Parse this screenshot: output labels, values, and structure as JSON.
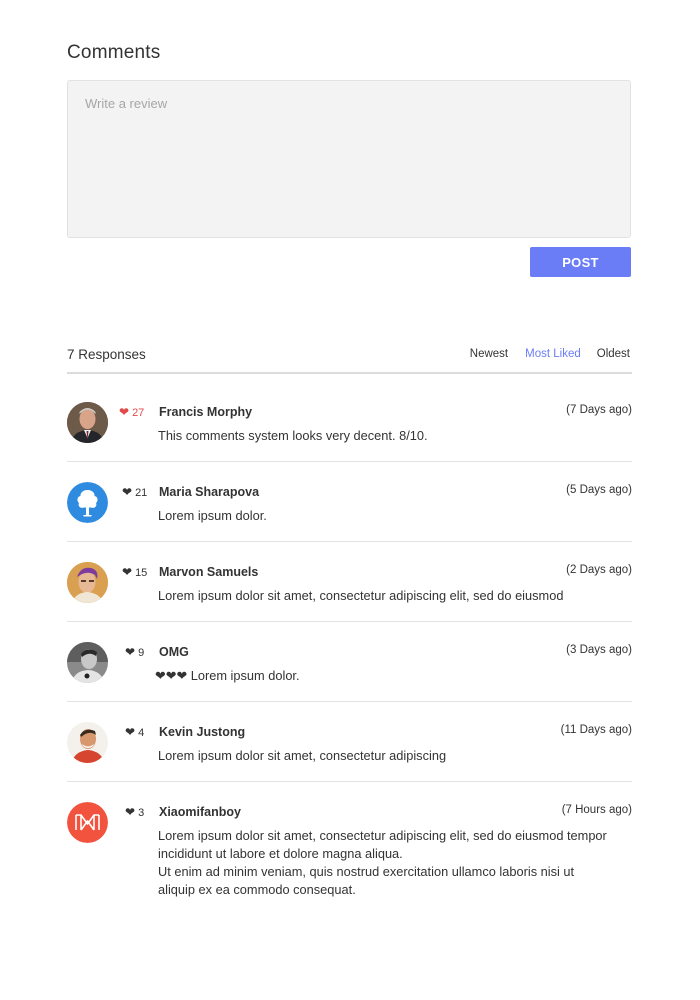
{
  "page": {
    "title": "Comments"
  },
  "composer": {
    "placeholder": "Write a review",
    "post_label": "POST"
  },
  "responses": {
    "count_label": "7 Responses",
    "sort_options": [
      "Newest",
      "Most Liked",
      "Oldest"
    ],
    "active_sort": "Most Liked"
  },
  "comments": [
    {
      "likes": "27",
      "author": "Francis Morphy",
      "time": "(7 Days ago)",
      "text": "This comments system looks very decent. 8/10.",
      "liked": true,
      "avatar": "avatar-photo-man-suit"
    },
    {
      "likes": "21",
      "author": "Maria Sharapova",
      "time": "(5 Days ago)",
      "text": "Lorem ipsum dolor.",
      "liked": false,
      "avatar": "avatar-tree-logo"
    },
    {
      "likes": "15",
      "author": "Marvon Samuels",
      "time": "(2 Days ago)",
      "text": "Lorem ipsum dolor sit amet, consectetur adipiscing elit, sed do eiusmod",
      "liked": false,
      "avatar": "avatar-photo-purple-hair"
    },
    {
      "likes": "9",
      "author": "OMG",
      "time": "(3 Days ago)",
      "text": "❤❤❤ Lorem ipsum dolor.",
      "liked": false,
      "avatar": "avatar-photo-grayscale"
    },
    {
      "likes": "4",
      "author": "Kevin Justong",
      "time": "(11 Days ago)",
      "text": "Lorem ipsum dolor sit amet, consectetur adipiscing",
      "liked": false,
      "avatar": "avatar-photo-red-shirt"
    },
    {
      "likes": "3",
      "author": "Xiaomifanboy",
      "time": "(7 Hours ago)",
      "text": "Lorem ipsum dolor sit amet, consectetur adipiscing elit, sed do eiusmod tempor incididunt ut labore et dolore magna aliqua.",
      "text2": "Ut enim ad minim veniam, quis nostrud exercitation ullamco laboris nisi ut aliquip ex ea commodo consequat.",
      "liked": false,
      "avatar": "avatar-mi-logo"
    }
  ],
  "colors": {
    "accent": "#6b7cf7",
    "like_active": "#e24a4a",
    "tree_logo": "#2f8be0",
    "mi_logo": "#f2533f"
  }
}
